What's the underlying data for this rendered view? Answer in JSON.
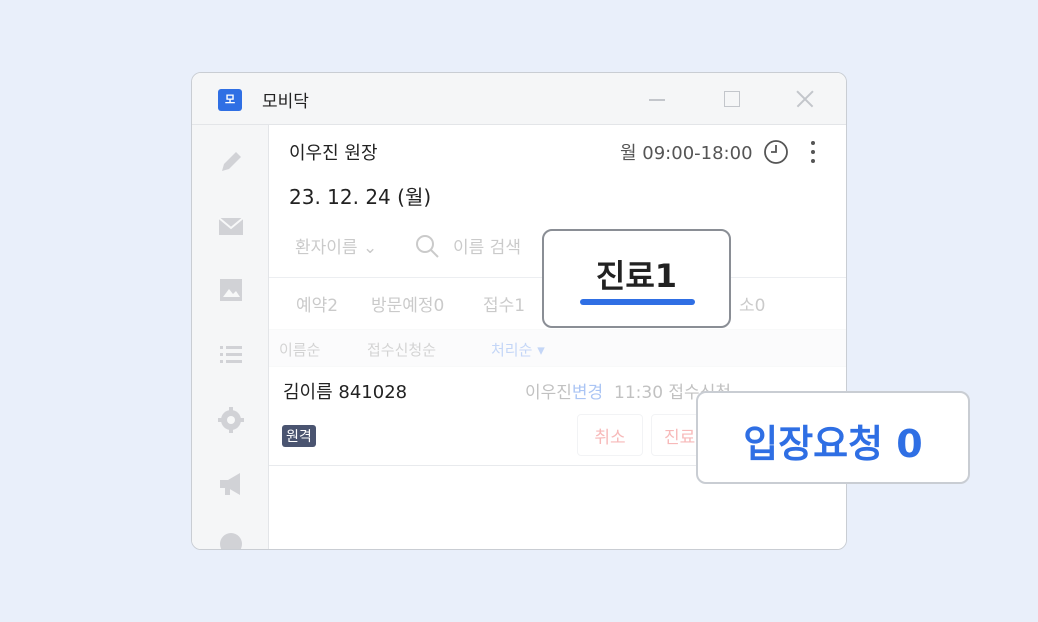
{
  "window": {
    "app_logo_text": "모",
    "title": "모비닥",
    "accent_color": "#2f6fe4"
  },
  "header": {
    "doctor": "이우진 원장",
    "hours": "월 09:00-18:00",
    "date": "23. 12. 24 (월)"
  },
  "filter": {
    "select_label": "환자이름",
    "search_placeholder": "이름 검색"
  },
  "tabs": [
    {
      "label": "예약2"
    },
    {
      "label": "방문예정0"
    },
    {
      "label": "접수1"
    },
    {
      "label": "소0"
    }
  ],
  "sort_options": [
    {
      "label": "이름순"
    },
    {
      "label": "접수신청순"
    },
    {
      "label": "처리순",
      "active": true
    }
  ],
  "patient": {
    "name": "김이름 841028",
    "doctor": "이우진",
    "change_label": "변경",
    "time_status": "11:30 접수신청",
    "badge": "원격",
    "cancel_label": "취소",
    "treat_label": "진료"
  },
  "callouts": {
    "treatment": "진료1",
    "entry_request": "입장요청 0"
  },
  "sidebar_icons": [
    "pencil-icon",
    "mail-icon",
    "image-icon",
    "list-icon",
    "gear-icon",
    "megaphone-icon",
    "chat-icon"
  ]
}
